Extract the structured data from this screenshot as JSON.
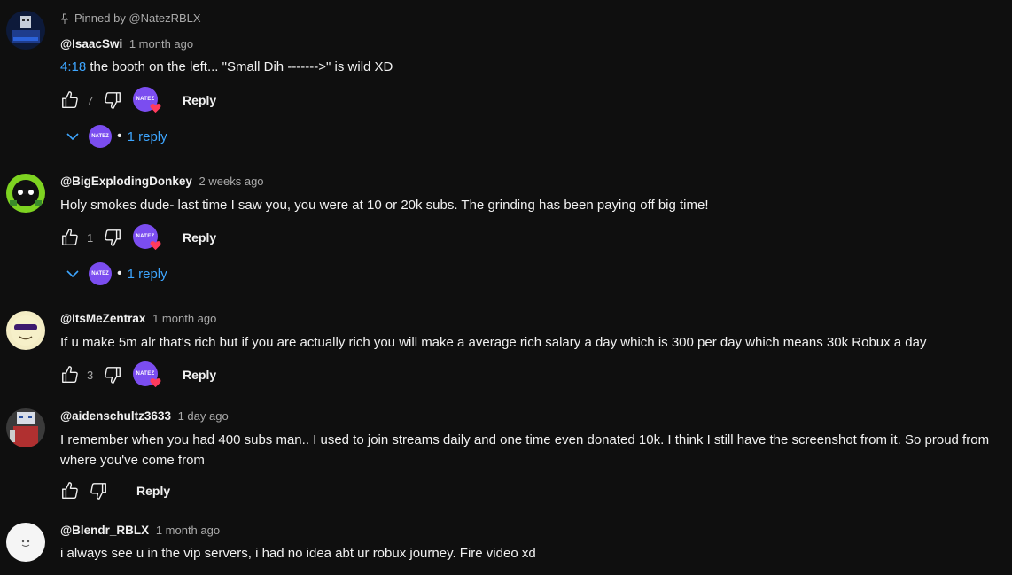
{
  "pinned_label": "Pinned by @NatezRBLX",
  "creator_logo_text": "NATEZ",
  "reply_label": "Reply",
  "comments": [
    {
      "author": "@IsaacSwi",
      "time": "1 month ago",
      "timestamp_link": "4:18",
      "text": " the booth on the left... \"Small Dih ------->\" is wild XD",
      "likes": "7",
      "hearted": true,
      "replies": "1 reply"
    },
    {
      "author": "@BigExplodingDonkey",
      "time": "2 weeks ago",
      "text": "Holy smokes dude- last time I saw you, you were at 10 or 20k subs. The grinding has been paying off big time!",
      "likes": "1",
      "hearted": true,
      "replies": "1 reply"
    },
    {
      "author": "@ItsMeZentrax",
      "time": "1 month ago",
      "text": "If u make 5m alr that's rich but if you are actually rich you will make a average rich salary a day which is 300 per day which means 30k Robux a day",
      "likes": "3",
      "hearted": true
    },
    {
      "author": "@aidenschultz3633",
      "time": "1 day ago",
      "text": "I remember when you had 400 subs man.. I used to join streams daily and one time even donated 10k. I think I still have the screenshot from it. So proud from where you've come from",
      "likes": "",
      "hearted": false
    },
    {
      "author": "@Blendr_RBLX",
      "time": "1 month ago",
      "text": "i always see u in the vip servers, i had no idea abt ur robux journey. Fire video xd"
    }
  ]
}
